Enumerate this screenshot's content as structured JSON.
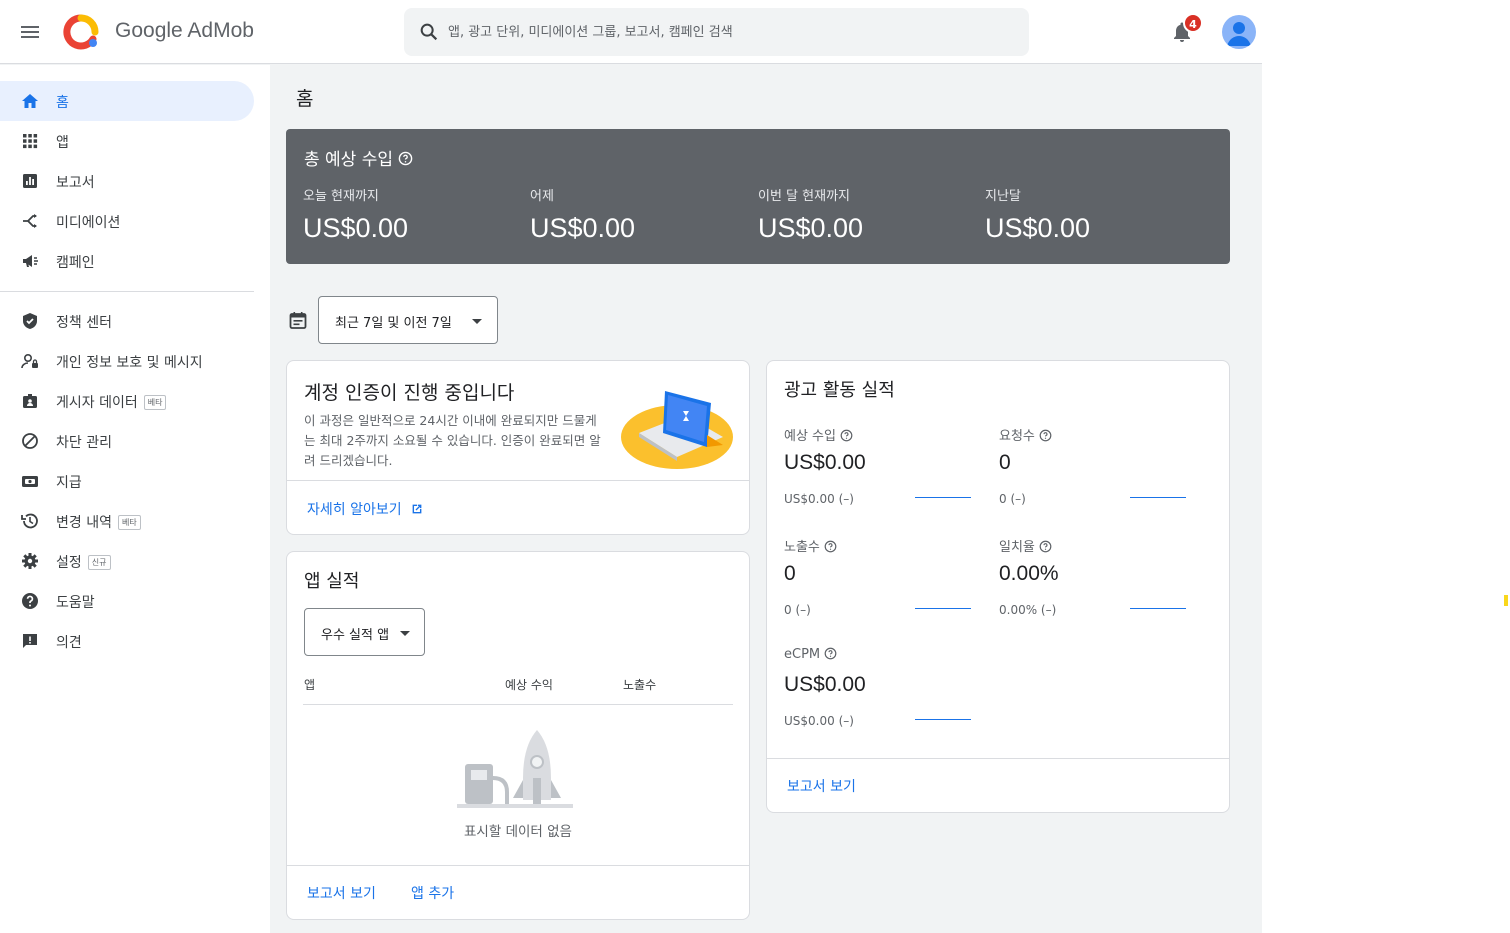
{
  "header": {
    "brand": "Google AdMob",
    "search_placeholder": "앱, 광고 단위, 미디에이션 그룹, 보고서, 캠페인 검색",
    "notification_count": "4",
    "accent_color": "#1a73e8"
  },
  "sidebar": {
    "items": [
      {
        "label": "홈",
        "icon": "home-icon",
        "active": true
      },
      {
        "label": "앱",
        "icon": "apps-grid-icon"
      },
      {
        "label": "보고서",
        "icon": "bar-chart-icon"
      },
      {
        "label": "미디에이션",
        "icon": "mediation-icon"
      },
      {
        "label": "캠페인",
        "icon": "campaign-icon"
      },
      {
        "label": "정책 센터",
        "icon": "shield-icon"
      },
      {
        "label": "개인 정보 보호 및 메시지",
        "icon": "privacy-icon"
      },
      {
        "label": "게시자 데이터",
        "icon": "badge-icon",
        "tag": "베타"
      },
      {
        "label": "차단 관리",
        "icon": "block-icon"
      },
      {
        "label": "지급",
        "icon": "payments-icon"
      },
      {
        "label": "변경 내역",
        "icon": "history-icon",
        "tag": "베타"
      },
      {
        "label": "설정",
        "icon": "gear-icon",
        "tag": "신규"
      },
      {
        "label": "도움말",
        "icon": "help-icon"
      },
      {
        "label": "의견",
        "icon": "feedback-icon"
      }
    ]
  },
  "page": {
    "title": "홈"
  },
  "earnings": {
    "title": "총 예상 수입",
    "columns": [
      {
        "label": "오늘 현재까지",
        "value": "US$0.00"
      },
      {
        "label": "어제",
        "value": "US$0.00"
      },
      {
        "label": "이번 달 현재까지",
        "value": "US$0.00"
      },
      {
        "label": "지난달",
        "value": "US$0.00"
      }
    ]
  },
  "date_range": {
    "selected": "최근 7일 및 이전 7일"
  },
  "verification": {
    "title": "계정 인증이 진행 중입니다",
    "body": "이 과정은 일반적으로 24시간 이내에 완료되지만 드물게는 최대 2주까지 소요될 수 있습니다. 인증이 완료되면 알려 드리겠습니다.",
    "link": "자세히 알아보기"
  },
  "app_performance": {
    "title": "앱 실적",
    "filter": "우수 실적 앱",
    "columns": [
      "앱",
      "예상 수익",
      "노출수"
    ],
    "empty_text": "표시할 데이터 없음",
    "links": [
      "보고서 보기",
      "앱 추가"
    ]
  },
  "ad_performance": {
    "title": "광고 활동 실적",
    "metrics": [
      {
        "label": "예상 수입",
        "value": "US$0.00",
        "sub": "US$0.00 (–)"
      },
      {
        "label": "요청수",
        "value": "0",
        "sub": "0 (–)"
      },
      {
        "label": "노출수",
        "value": "0",
        "sub": "0 (–)"
      },
      {
        "label": "일치율",
        "value": "0.00%",
        "sub": "0.00% (–)"
      },
      {
        "label": "eCPM",
        "value": "US$0.00",
        "sub": "US$0.00 (–)"
      }
    ],
    "link": "보고서 보기"
  }
}
